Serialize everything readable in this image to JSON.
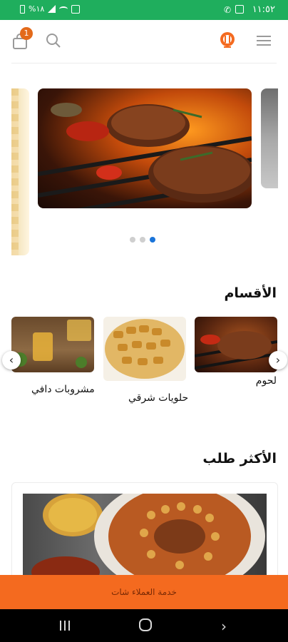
{
  "status_bar": {
    "time": "١١:٥٢",
    "battery": "%١٨",
    "icons_right": [
      "gallery-icon",
      "phone-icon"
    ],
    "icons_left": [
      "alarm-icon",
      "signal-icon",
      "wifi-icon",
      "battery-icon"
    ]
  },
  "header": {
    "cart_badge": "1",
    "icons": [
      "menu-icon",
      "logo-icon",
      "search-icon",
      "cart-icon"
    ]
  },
  "hero": {
    "dots_count": 3,
    "active_dot_index": 2
  },
  "categories": {
    "title": "الأقسام",
    "items": [
      {
        "label": "لحوم"
      },
      {
        "label": "حلويات شرقي"
      },
      {
        "label": "مشروبات دافي"
      }
    ]
  },
  "most_ordered": {
    "title": "الأكثر طلب"
  },
  "chat": {
    "label": "خدمة العملاء شات"
  },
  "colors": {
    "status_bar": "#1fae5d",
    "accent_orange": "#f46a1f",
    "badge": "#e36a1a",
    "active_dot": "#1a74d9"
  }
}
